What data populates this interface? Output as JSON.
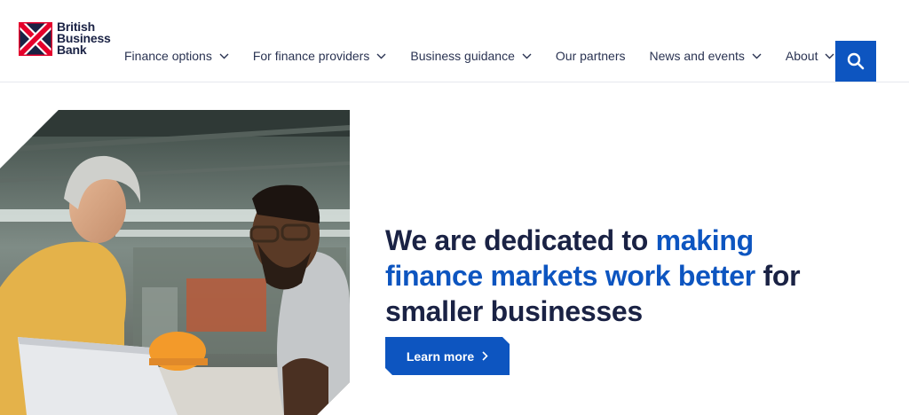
{
  "brand": {
    "line1": "British",
    "line2": "Business",
    "line3": "Bank",
    "colors": {
      "navy": "#1a2244",
      "red": "#e4002b",
      "blue": "#0d55c0"
    }
  },
  "nav": {
    "items": [
      {
        "label": "Finance options",
        "dropdown": true
      },
      {
        "label": "For finance providers",
        "dropdown": true
      },
      {
        "label": "Business guidance",
        "dropdown": true
      },
      {
        "label": "Our partners",
        "dropdown": false
      },
      {
        "label": "News and events",
        "dropdown": true
      },
      {
        "label": "About",
        "dropdown": true
      }
    ],
    "search_icon": "search-icon"
  },
  "hero": {
    "headline_part1": "We are dedicated to ",
    "headline_highlight": "making finance markets work better",
    "headline_part2": " for smaller businesses",
    "cta_label": "Learn more",
    "cta_icon": "chevron-right-icon",
    "image_subject": "photo"
  }
}
